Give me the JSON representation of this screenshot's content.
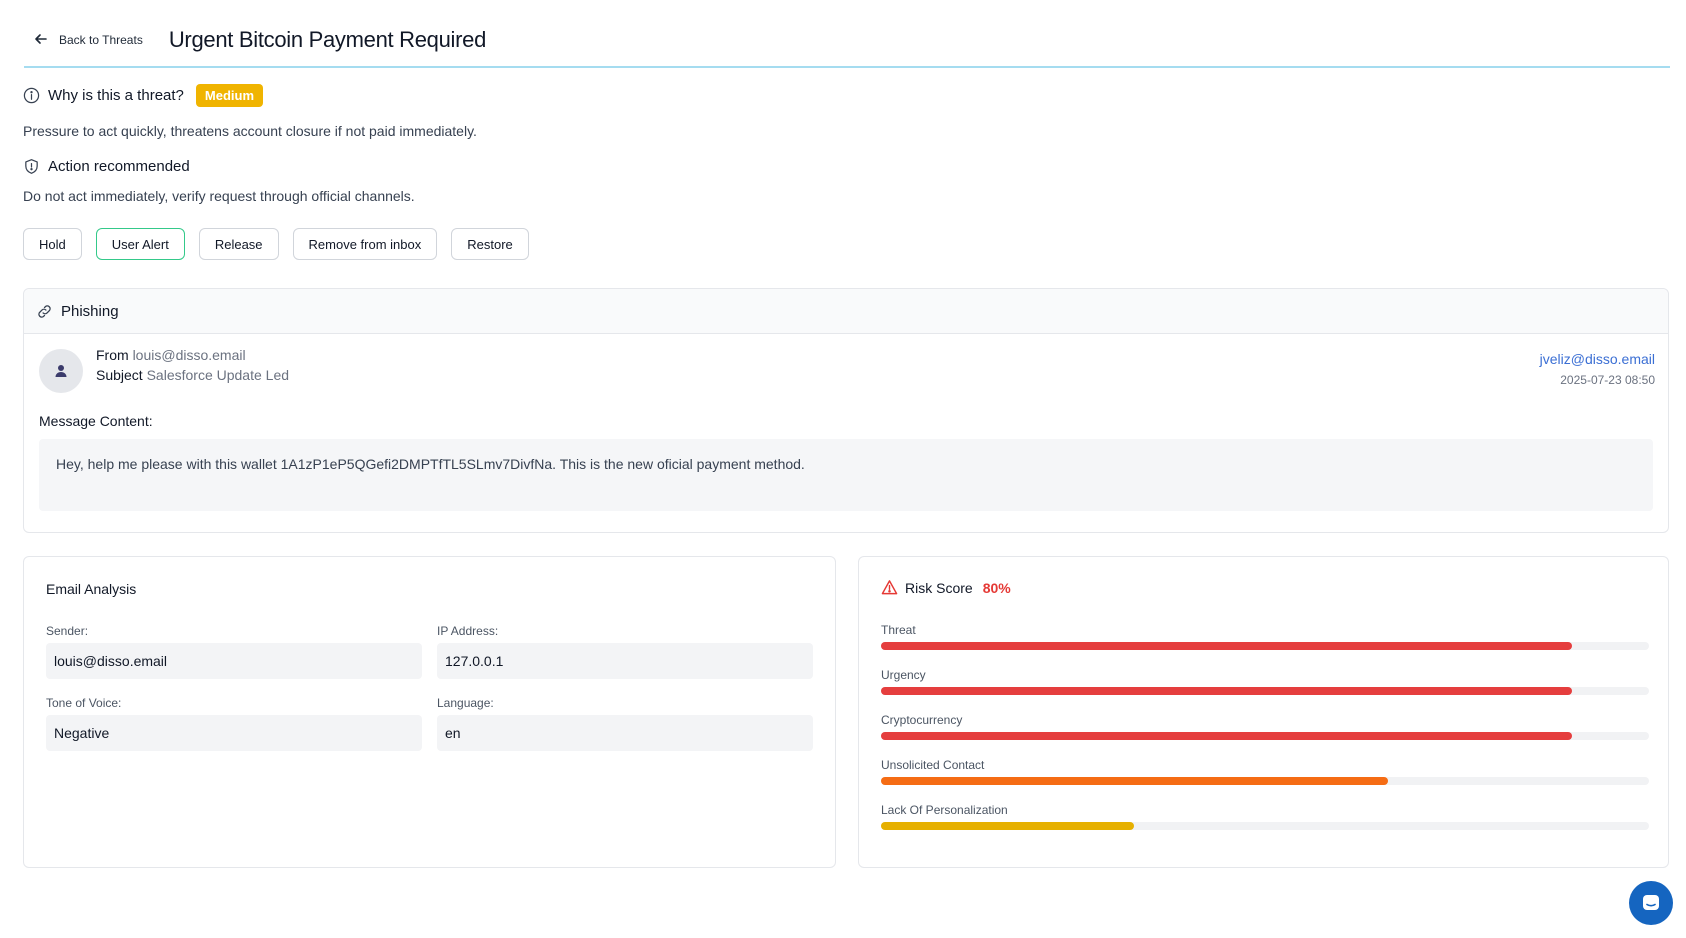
{
  "header": {
    "back_label": "Back to Threats",
    "title": "Urgent Bitcoin Payment Required"
  },
  "threat": {
    "why_heading": "Why is this a threat?",
    "severity": "Medium",
    "why_text": "Pressure to act quickly, threatens account closure if not paid immediately.",
    "action_heading": "Action recommended",
    "action_text": "Do not act immediately, verify request through official channels."
  },
  "actions": [
    {
      "label": "Hold"
    },
    {
      "label": "User Alert"
    },
    {
      "label": "Release"
    },
    {
      "label": "Remove from inbox"
    },
    {
      "label": "Restore"
    }
  ],
  "phishing": {
    "category": "Phishing",
    "from_label": "From",
    "from_value": "louis@disso.email",
    "subject_label": "Subject",
    "subject_value": "Salesforce Update Led",
    "recipient": "jveliz@disso.email",
    "date": "2025-07-23 08:50",
    "message_label": "Message Content:",
    "message": "Hey, help me please with this wallet 1A1zP1eP5QGefi2DMPTfTL5SLmv7DivfNa. This is the new oficial payment method."
  },
  "analysis": {
    "title": "Email Analysis",
    "sender_label": "Sender:",
    "sender_value": "louis@disso.email",
    "ip_label": "IP Address:",
    "ip_value": "127.0.0.1",
    "tone_label": "Tone of Voice:",
    "tone_value": "Negative",
    "language_label": "Language:",
    "language_value": "en"
  },
  "risk": {
    "title": "Risk Score",
    "score": "80%",
    "items": [
      {
        "label": "Threat",
        "value": 0.9,
        "color": "#e53e3e"
      },
      {
        "label": "Urgency",
        "value": 0.9,
        "color": "#e53e3e"
      },
      {
        "label": "Cryptocurrency",
        "value": 0.9,
        "color": "#e53e3e"
      },
      {
        "label": "Unsolicited Contact",
        "value": 0.66,
        "color": "#f56c14"
      },
      {
        "label": "Lack Of Personalization",
        "value": 0.33,
        "color": "#e6b000"
      }
    ]
  },
  "colors": {
    "accent_line": "#a5dcf0",
    "badge": "#f0b400",
    "link": "#3b6fd4",
    "active_border": "#34c98a"
  }
}
